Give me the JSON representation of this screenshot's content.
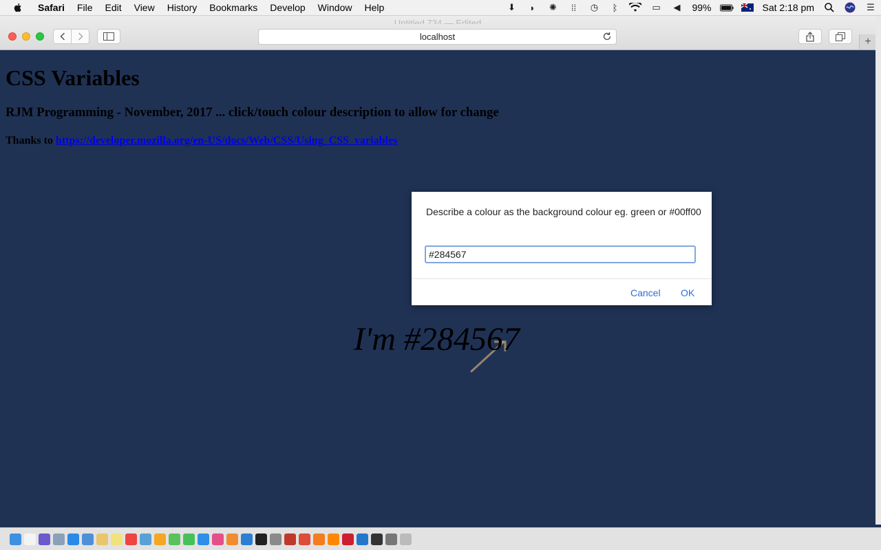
{
  "menubar": {
    "app_name": "Safari",
    "items": [
      "File",
      "Edit",
      "View",
      "History",
      "Bookmarks",
      "Develop",
      "Window",
      "Help"
    ],
    "battery": "99%",
    "clock": "Sat 2:18 pm"
  },
  "window": {
    "title": "Untitled 734 — Edited",
    "url": "localhost",
    "new_tab_symbol": "+"
  },
  "page": {
    "heading": "CSS Variables",
    "subheading": "RJM Programming - November, 2017 ... click/touch colour description to allow for change",
    "thanks_prefix": "Thanks to",
    "thanks_link": "https://developer.mozilla.org/en-US/docs/Web/CSS/Using_CSS_variables",
    "colour_label": "I'm #284567"
  },
  "dialog": {
    "message": "Describe a colour as the background colour eg. green or #00ff00",
    "input_value": "#284567",
    "cancel_label": "Cancel",
    "ok_label": "OK"
  },
  "colors": {
    "page_background": "#1f3254",
    "link": "#0000ee",
    "dialog_button": "#2f6cd6",
    "input_focus": "#7ea7e2"
  },
  "dock": {
    "apps": [
      "finder-icon",
      "file-icon",
      "siri-icon",
      "launchpad-icon",
      "safari-icon",
      "mail-icon",
      "notes-icon",
      "stickies-icon",
      "calendar-icon",
      "preview-icon",
      "photos-icon",
      "messages-icon",
      "facetime-icon",
      "app-store-icon",
      "itunes-icon",
      "ibooks-icon",
      "xcode-icon",
      "terminal-icon",
      "activity-icon",
      "filezilla-icon",
      "chrome-icon",
      "firefox-icon",
      "vlc-icon",
      "opera-icon",
      "vscode-icon",
      "github-icon",
      "system-prefs-icon",
      "trash-icon"
    ]
  }
}
